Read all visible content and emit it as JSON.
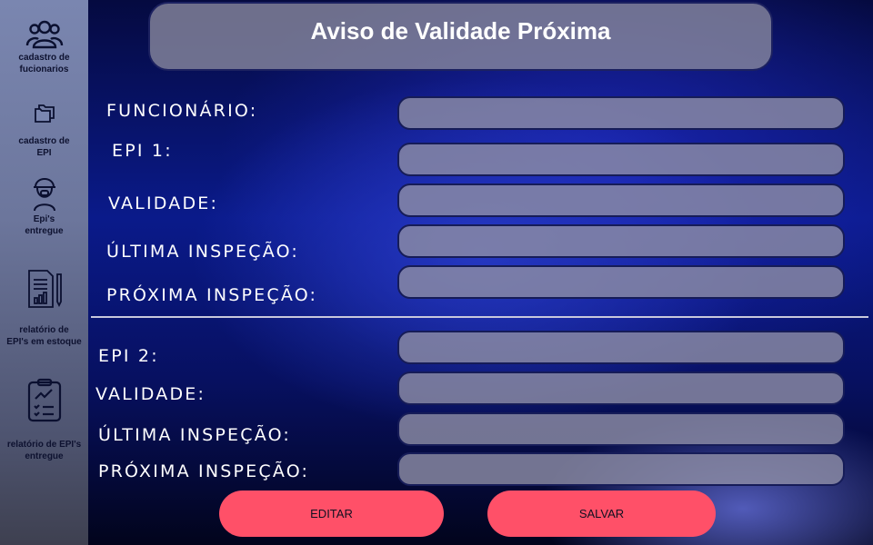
{
  "sidebar": {
    "items": [
      {
        "label_line1": "cadastro de",
        "label_line2": "fucionarios",
        "icon": "users-icon"
      },
      {
        "label_line1": "cadastro de",
        "label_line2": "EPI",
        "icon": "folders-icon"
      },
      {
        "label_line1": "Epi's",
        "label_line2": "entregue",
        "icon": "safety-worker-icon"
      },
      {
        "label_line1": "relatório de",
        "label_line2": "EPI's em estoque",
        "icon": "report-chart-icon"
      },
      {
        "label_line1": "relatório de EPI's",
        "label_line2": "entregue",
        "icon": "clipboard-checklist-icon"
      }
    ]
  },
  "header": {
    "title": "Aviso de Validade Próxima"
  },
  "form": {
    "section1": {
      "funcionario_label": "FUNCIONÁRIO:",
      "epi_label": "EPI 1:",
      "validade_label": "VALIDADE:",
      "ultima_label": "ÚLTIMA INSPEÇÃO:",
      "proxima_label": "PRÓXIMA INSPEÇÃO:"
    },
    "section2": {
      "epi_label": "EPI 2:",
      "validade_label": "VALIDADE:",
      "ultima_label": "ÚLTIMA INSPEÇÃO:",
      "proxima_label": "PRÓXIMA INSPEÇÃO:"
    },
    "values": {
      "funcionario": "",
      "epi1": "",
      "validade1": "",
      "ultima1": "",
      "proxima1": "",
      "epi2": "",
      "validade2": "",
      "ultima2": "",
      "proxima2": ""
    }
  },
  "buttons": {
    "edit": "EDITAR",
    "save": "SALVAR"
  },
  "colors": {
    "accent_button": "#ff5068",
    "field_bg": "#8c8ca5",
    "sidebar": "#6c769c"
  }
}
